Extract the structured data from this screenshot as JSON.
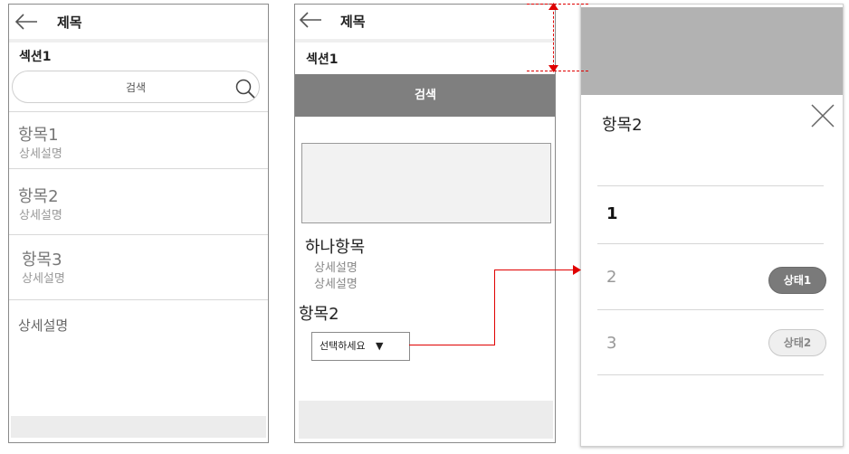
{
  "screen1": {
    "title": "제목",
    "section": "섹션1",
    "search": {
      "placeholder": "검색"
    },
    "items": [
      {
        "title": "항목1",
        "desc": "상세설명"
      },
      {
        "title": "항목2",
        "desc": "상세설명"
      },
      {
        "title": "항목3",
        "desc": "상세설명"
      }
    ],
    "footer_text": "상세설명"
  },
  "screen2": {
    "title": "제목",
    "section": "섹션1",
    "search_button": "검색",
    "single_item": {
      "title": "하나항목",
      "desc1": "상세설명",
      "desc2": "상세설명"
    },
    "item2_label": "항목2",
    "select": {
      "value": "선택하세요",
      "arrow": "▼"
    }
  },
  "screen3": {
    "title": "항목2",
    "options": [
      {
        "number": "1",
        "badge": ""
      },
      {
        "number": "2",
        "badge": "상태1"
      },
      {
        "number": "3",
        "badge": "상태2"
      }
    ]
  },
  "colors": {
    "annotation": "#e00000",
    "bar_dark": "#7f7f7f",
    "panel_gray": "#b2b2b2"
  }
}
